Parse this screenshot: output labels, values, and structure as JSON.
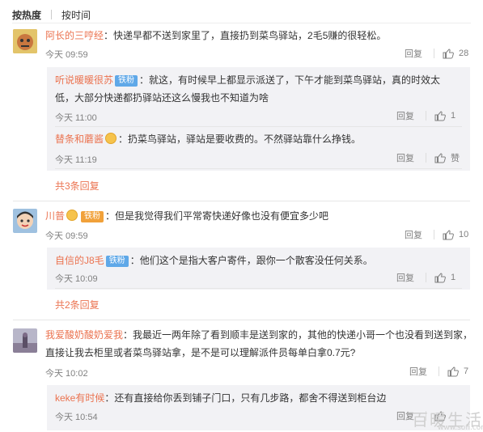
{
  "sort": {
    "hot": "按热度",
    "time": "按时间"
  },
  "labels": {
    "reply": "回复"
  },
  "colors": {
    "accent": "#eb7350",
    "sub_bg": "#f2f2f5",
    "badge_blue": "#5fa8e8",
    "badge_orange": "#f1a13a"
  },
  "comments": [
    {
      "name": "阿长的三哼经",
      "text": "快递早都不送到家里了，直接扔到菜鸟驿站，2毛5赚的很轻松。",
      "time": "今天 09:59",
      "likes": "28",
      "replies": [
        {
          "name": "听说暖暖很苏",
          "badge": "铁粉",
          "text": "就这，有时候早上都显示派送了，下午才能到菜鸟驿站，真的时效太低，大部分快递都扔驿站还这么慢我也不知道为啥",
          "time": "今天 11:00",
          "likes": "1"
        },
        {
          "name": "替条和蘑酱",
          "text": "扔菜鸟驿站，驿站是要收费的。不然驿站靠什么挣钱。",
          "time": "今天 11:19",
          "likes": "赞"
        }
      ],
      "more": "共3条回复"
    },
    {
      "name": "川普",
      "badge": "铁粉",
      "text": "但是我觉得我们平常寄快递好像也没有便宜多少吧",
      "time": "今天 09:59",
      "likes": "10",
      "replies": [
        {
          "name": "自信的J8毛",
          "badge": "铁粉",
          "text": "他们这个是指大客户寄件，跟你一个散客没任何关系。",
          "time": "今天 10:09",
          "likes": "1"
        }
      ],
      "more": "共2条回复"
    },
    {
      "name": "我爱酸奶酸奶爱我",
      "text": "我最近一两年除了看到顺丰是送到家的，其他的快递小哥一个也没看到送到家，直接让我去柜里或者菜鸟驿站拿，是不是可以理解派件员每单白拿0.7元?",
      "time": "今天 10:02",
      "likes": "7",
      "replies": [
        {
          "name": "keke有时候",
          "text": "还有直接给你丢到铺子门口，只有几步路，都舍不得送到柜台边",
          "time": "今天 10:54",
          "likes": ""
        }
      ]
    }
  ],
  "watermark": {
    "main": "百暖生活",
    "sub": "www.sofi.com"
  }
}
